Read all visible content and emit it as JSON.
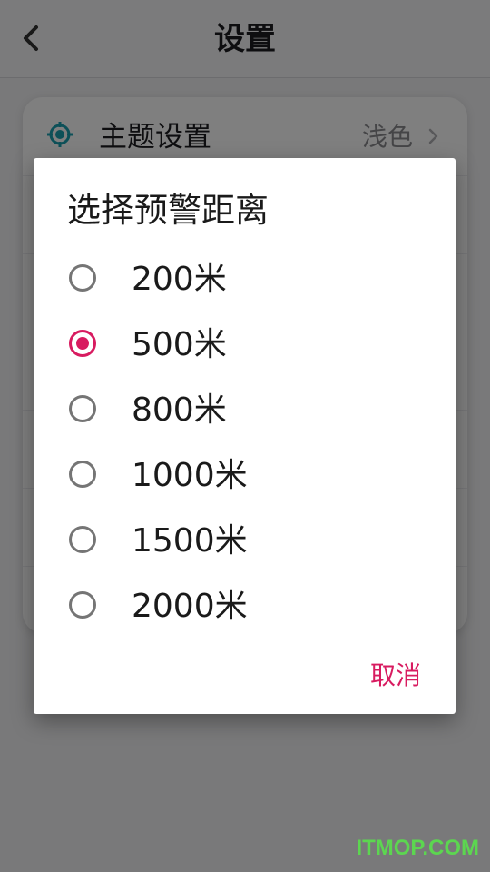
{
  "page": {
    "title": "设置",
    "back_icon": "chevron-left-icon"
  },
  "settings": {
    "rows": [
      {
        "label": "主题设置",
        "value": "浅色",
        "icon": "target-icon",
        "icon_color": "#1ba0b0"
      }
    ]
  },
  "dialog": {
    "title": "选择预警距离",
    "options": [
      {
        "label": "200米",
        "checked": false
      },
      {
        "label": "500米",
        "checked": true
      },
      {
        "label": "800米",
        "checked": false
      },
      {
        "label": "1000米",
        "checked": false
      },
      {
        "label": "1500米",
        "checked": false
      },
      {
        "label": "2000米",
        "checked": false
      }
    ],
    "cancel_label": "取消"
  },
  "watermark": "ITMOP.COM",
  "colors": {
    "accent": "#d81b60",
    "radio_unchecked": "#757575",
    "scrim": "rgba(0,0,0,0.5)"
  }
}
